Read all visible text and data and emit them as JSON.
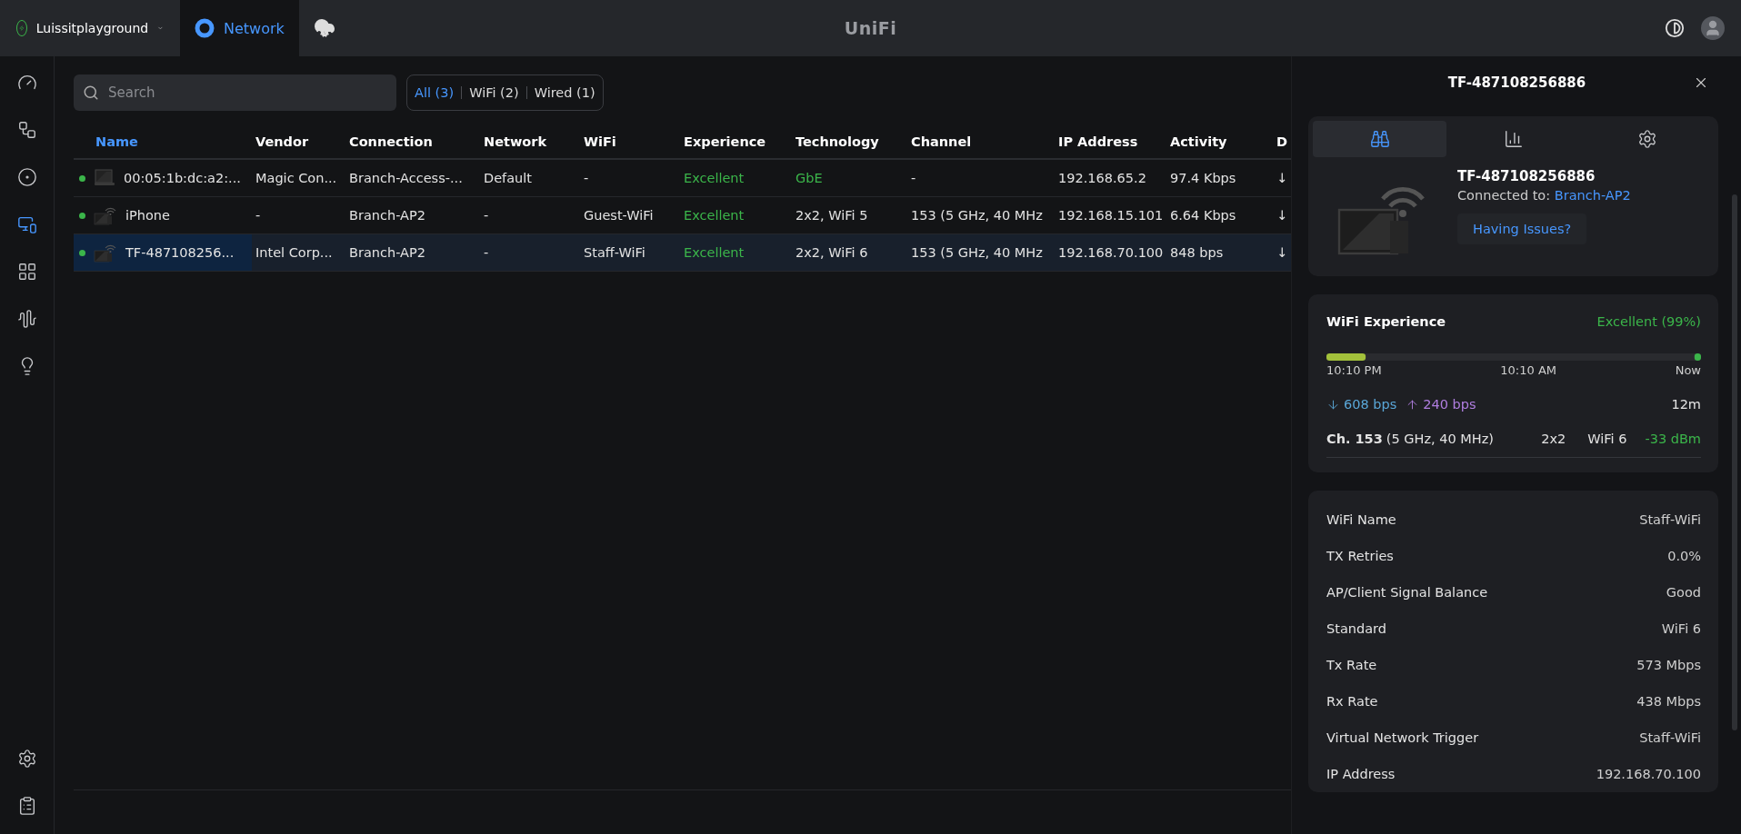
{
  "topbar": {
    "site": "Luissitplayground",
    "apps": [
      {
        "kind": "network",
        "label": "Network",
        "selected": true
      },
      {
        "kind": "cloud",
        "selected": false
      }
    ],
    "brand": "UniFi"
  },
  "sidebar": {
    "items": [
      {
        "kind": "dashboard",
        "selected": false
      },
      {
        "kind": "topology",
        "selected": false
      },
      {
        "kind": "devices",
        "selected": false
      },
      {
        "kind": "clients",
        "selected": true
      },
      {
        "kind": "ports",
        "selected": false
      },
      {
        "kind": "insights",
        "selected": false
      },
      {
        "kind": "alerts",
        "selected": false
      }
    ],
    "bottom": [
      {
        "kind": "settings",
        "selected": false
      },
      {
        "kind": "logs",
        "selected": false
      }
    ]
  },
  "search": {
    "placeholder": "Search"
  },
  "filters": [
    {
      "label": "All (3)",
      "selected": true
    },
    {
      "label": "WiFi (2)",
      "selected": false
    },
    {
      "label": "Wired (1)",
      "selected": false
    }
  ],
  "table": {
    "columns": [
      {
        "label": "Name",
        "sorted": true
      },
      {
        "label": "Vendor",
        "sorted": false
      },
      {
        "label": "Connection",
        "sorted": false
      },
      {
        "label": "Network",
        "sorted": false
      },
      {
        "label": "WiFi",
        "sorted": false
      },
      {
        "label": "Experience",
        "sorted": false
      },
      {
        "label": "Technology",
        "sorted": false
      },
      {
        "label": "Channel",
        "sorted": false
      },
      {
        "label": "IP Address",
        "sorted": false
      },
      {
        "label": "Activity",
        "sorted": false
      },
      {
        "label": "D",
        "sorted": false
      }
    ],
    "rows": [
      {
        "kind": "monitor",
        "online": true,
        "selected": false,
        "cells": [
          {
            "text": "00:05:1b:dc:a2:...",
            "good": false
          },
          {
            "text": "Magic Con...",
            "good": false
          },
          {
            "text": "Branch-Access-...",
            "good": false
          },
          {
            "text": "Default",
            "good": false
          },
          {
            "text": "-",
            "good": false
          },
          {
            "text": "Excellent",
            "good": true
          },
          {
            "text": "GbE",
            "good": true
          },
          {
            "text": "-",
            "good": false
          },
          {
            "text": "192.168.65.2",
            "good": false
          },
          {
            "text": "97.4 Kbps",
            "good": false
          },
          {
            "text": "↓",
            "good": false
          }
        ]
      },
      {
        "kind": "wireless",
        "online": true,
        "selected": false,
        "cells": [
          {
            "text": "iPhone",
            "good": false
          },
          {
            "text": "-",
            "good": false
          },
          {
            "text": "Branch-AP2",
            "good": false
          },
          {
            "text": "-",
            "good": false
          },
          {
            "text": "Guest-WiFi",
            "good": false
          },
          {
            "text": "Excellent",
            "good": true
          },
          {
            "text": "2x2, WiFi 5",
            "good": false
          },
          {
            "text": "153 (5 GHz, 40 MHz",
            "good": false
          },
          {
            "text": "192.168.15.101",
            "good": false
          },
          {
            "text": "6.64 Kbps",
            "good": false
          },
          {
            "text": "↓",
            "good": false
          }
        ]
      },
      {
        "kind": "wireless",
        "online": true,
        "selected": true,
        "cells": [
          {
            "text": "TF-487108256...",
            "good": false
          },
          {
            "text": "Intel Corp...",
            "good": false
          },
          {
            "text": "Branch-AP2",
            "good": false
          },
          {
            "text": "-",
            "good": false
          },
          {
            "text": "Staff-WiFi",
            "good": false
          },
          {
            "text": "Excellent",
            "good": true
          },
          {
            "text": "2x2, WiFi 6",
            "good": false
          },
          {
            "text": "153 (5 GHz, 40 MHz",
            "good": false
          },
          {
            "text": "192.168.70.100",
            "good": false
          },
          {
            "text": "848 bps",
            "good": false
          },
          {
            "text": "↓",
            "good": false
          }
        ]
      }
    ]
  },
  "panel": {
    "title": "TF-487108256886",
    "tabs": [
      {
        "kind": "overview",
        "selected": true
      },
      {
        "kind": "stats",
        "selected": false
      },
      {
        "kind": "settings",
        "selected": false
      }
    ],
    "device": {
      "name": "TF-487108256886",
      "connected_label": "Connected to:",
      "connected_link": "Branch-AP2",
      "issues_button": "Having Issues?"
    },
    "experience": {
      "title": "WiFi Experience",
      "rating": "Excellent (99%)",
      "times": [
        "10:10 PM",
        "10:10 AM",
        "Now"
      ],
      "down": "608 bps",
      "up": "240 bps",
      "duration": "12m",
      "channel": "**Ch. 153** (5 GHz, 40 MHz)",
      "streams": "2x2",
      "standard": "WiFi 6",
      "signal": "-33 dBm"
    },
    "details": [
      {
        "label": "WiFi Name",
        "value": "Staff-WiFi"
      },
      {
        "label": "TX Retries",
        "value": "0.0%"
      },
      {
        "label": "AP/Client Signal Balance",
        "value": "Good"
      },
      {
        "label": "Standard",
        "value": "WiFi 6"
      },
      {
        "label": "Tx Rate",
        "value": "573 Mbps"
      },
      {
        "label": "Rx Rate",
        "value": "438 Mbps"
      },
      {
        "label": "Virtual Network Trigger",
        "value": "Staff-WiFi"
      },
      {
        "label": "IP Address",
        "value": "192.168.70.100"
      }
    ]
  }
}
